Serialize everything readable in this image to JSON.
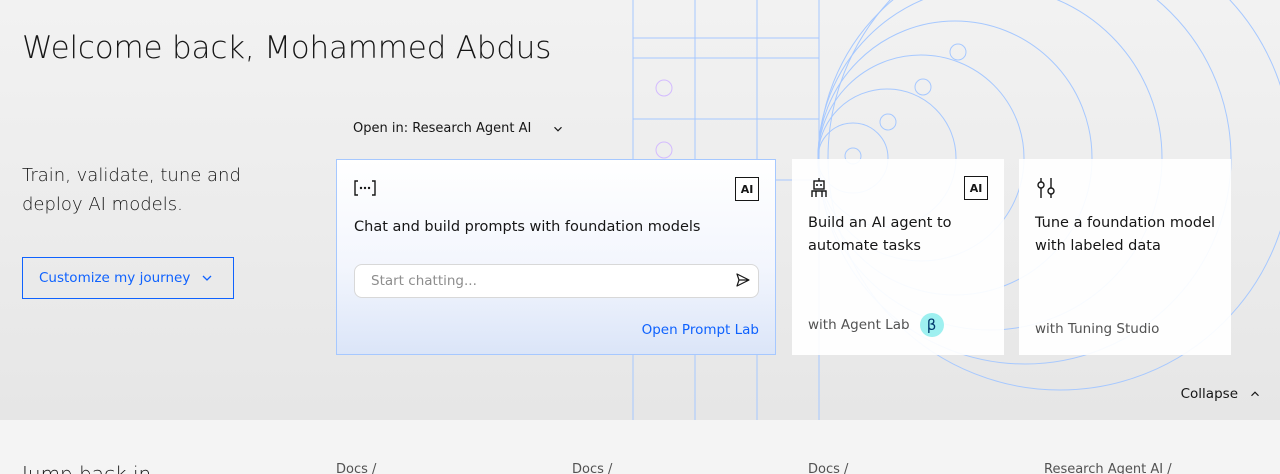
{
  "hero": {
    "welcome": "Welcome back, Mohammed Abdus",
    "tagline": "Train, validate, tune and deploy AI models.",
    "customize_label": "Customize my journey",
    "open_in_label": "Open in: Research Agent AI",
    "collapse_label": "Collapse"
  },
  "cards": {
    "chat": {
      "icon": "prompt-brackets-icon",
      "badge": "AI",
      "title": "Chat and build prompts with foundation models",
      "input_placeholder": "Start chatting...",
      "link": "Open Prompt Lab"
    },
    "agent": {
      "icon": "robot-icon",
      "badge": "AI",
      "title": "Build an AI agent to automate tasks",
      "footer": "with Agent Lab",
      "beta": "β"
    },
    "tune": {
      "icon": "sliders-icon",
      "title": "Tune a foundation model with labeled data",
      "footer": "with Tuning Studio"
    }
  },
  "bottom": {
    "heading": "Jump back in",
    "crumbs": [
      "Docs /",
      "Docs /",
      "Docs /",
      "Research Agent AI /"
    ]
  },
  "colors": {
    "accent": "#0f62fe",
    "beta_bg": "#9ef0f0",
    "art_line": "#a6c8ff",
    "art_circle_purple": "#d4bbff"
  }
}
